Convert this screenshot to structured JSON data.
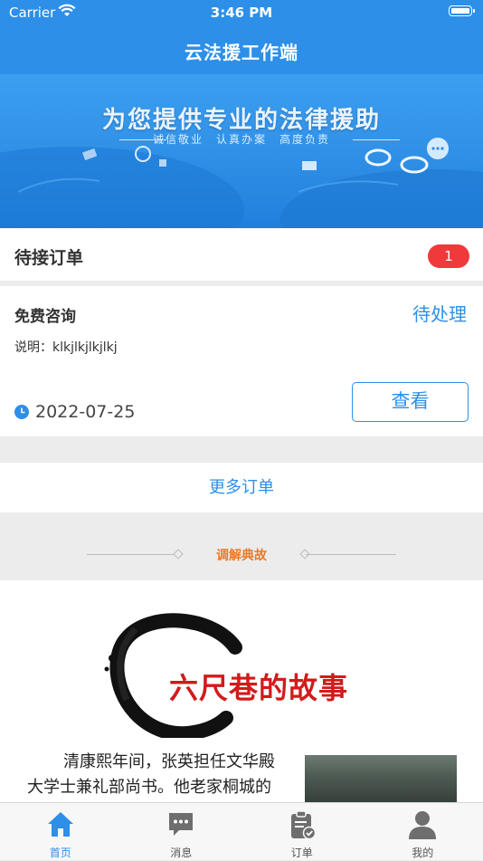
{
  "status_bar": {
    "carrier": "Carrier",
    "time": "3:46 PM"
  },
  "nav": {
    "title": "云法援工作端"
  },
  "banner": {
    "headline": "为您提供专业的法律援助",
    "subline": "诚信敬业　认真办案　高度负责"
  },
  "pending": {
    "title": "待接订单",
    "badge_count": "1",
    "order": {
      "type": "免费咨询",
      "status": "待处理",
      "description": "说明：klkjlkjlkjlkj",
      "date": "2022-07-25",
      "view_button": "查看"
    },
    "more_label": "更多订单"
  },
  "section": {
    "title": "调解典故"
  },
  "story": {
    "title": "六尺巷的故事",
    "text": "清康熙年间，张英担任文华殿大学士兼礼部尚书。他老家桐城的官邸与吴家为邻"
  },
  "tabbar": {
    "tabs": [
      {
        "label": "首页",
        "icon": "home-icon",
        "active": true
      },
      {
        "label": "消息",
        "icon": "message-icon",
        "active": false
      },
      {
        "label": "订单",
        "icon": "clipboard-icon",
        "active": false
      },
      {
        "label": "我的",
        "icon": "user-icon",
        "active": false
      }
    ]
  },
  "colors": {
    "primary": "#2d8fe8",
    "badge": "#f0393b",
    "section_title": "#e87a2a",
    "story_title": "#d11b1b"
  }
}
